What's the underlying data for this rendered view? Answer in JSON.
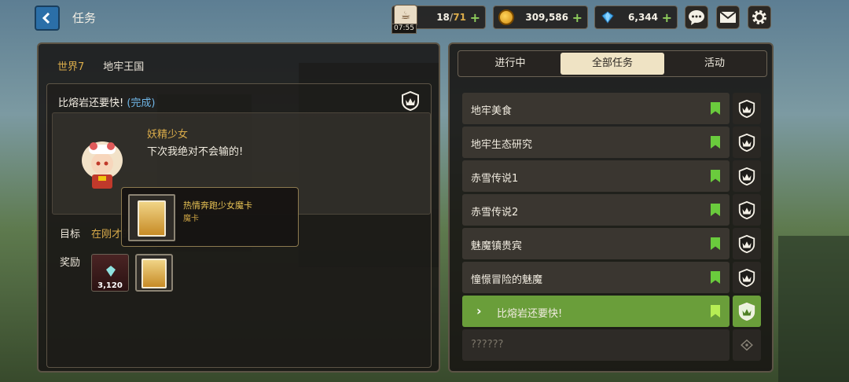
{
  "header": {
    "title": "任务",
    "stamina": {
      "current": "18",
      "max": "71",
      "timer": "07:55"
    },
    "gold": "309,586",
    "gems": "6,344",
    "plus": "+"
  },
  "left": {
    "world": "世界7",
    "realm": "地牢王国",
    "quest_title": "比熔岩还要快!",
    "quest_status": "(完成)",
    "npc_name": "妖精少女",
    "npc_line": "下次我绝对不会输的!",
    "goal_label": "目标",
    "goal_text": "在刚才的",
    "reward_label": "奖励",
    "reward_gem_count": "3,120",
    "tooltip_name": "热情奔跑少女魔卡",
    "tooltip_type": "魔卡"
  },
  "tabs": [
    "进行中",
    "全部任务",
    "活动"
  ],
  "active_tab": "全部任务",
  "quests": [
    {
      "label": "地牢美食",
      "state": "normal"
    },
    {
      "label": "地牢生态研究",
      "state": "normal"
    },
    {
      "label": "赤雪传说1",
      "state": "normal"
    },
    {
      "label": "赤雪传说2",
      "state": "normal"
    },
    {
      "label": "魅魔镇贵宾",
      "state": "normal"
    },
    {
      "label": "憧憬冒险的魅魔",
      "state": "normal"
    },
    {
      "label": "比熔岩还要快!",
      "state": "active"
    },
    {
      "label": "??????",
      "state": "locked"
    }
  ],
  "colors": {
    "accent_gold": "#d9ab4a",
    "active_green": "#6a9e3a",
    "bookmark_green": "#6acb3d",
    "done_blue": "#6fb6e6"
  }
}
